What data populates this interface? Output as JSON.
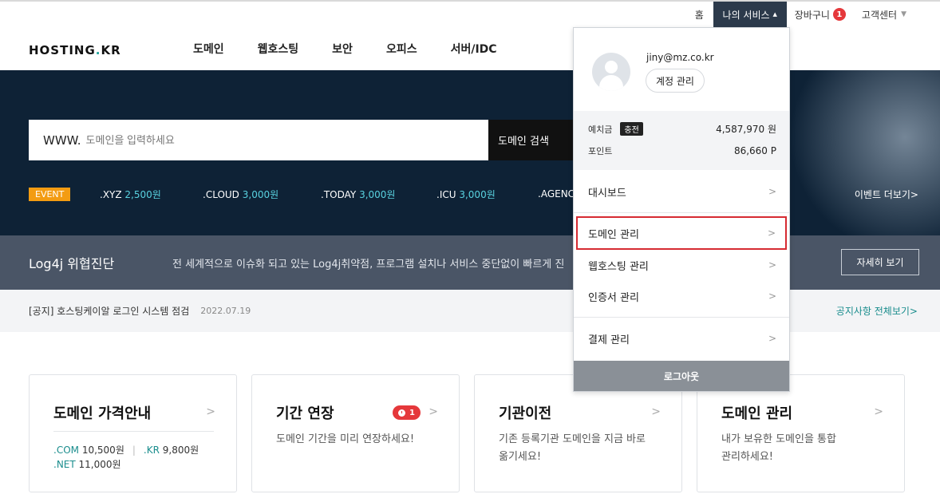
{
  "util": {
    "home": "홈",
    "my_services": "나의 서비스",
    "cart": "장바구니",
    "cart_count": "1",
    "support": "고객센터"
  },
  "logo": {
    "text_a": "HOSTING",
    "dot": ".",
    "text_b": "KR"
  },
  "gnb": [
    "도메인",
    "웹호스팅",
    "보안",
    "오피스",
    "서버/IDC"
  ],
  "search": {
    "prefix": "WWW.",
    "placeholder": "도메인을 입력하세요",
    "button": "도메인 검색"
  },
  "events": {
    "tag": "EVENT",
    "items": [
      {
        "tld": ".XYZ",
        "price": "2,500원"
      },
      {
        "tld": ".CLOUD",
        "price": "3,000원"
      },
      {
        "tld": ".TODAY",
        "price": "3,000원"
      },
      {
        "tld": ".ICU",
        "price": "3,000원"
      },
      {
        "tld": ".AGENC",
        "price": ""
      }
    ],
    "more": "이벤트 더보기>"
  },
  "alert": {
    "title": "Log4j 위협진단",
    "desc": "전 세계적으로 이슈화 되고 있는 Log4j취약점, 프로그램 설치나 서비스 중단없이 빠르게 진",
    "button": "자세히 보기"
  },
  "notice": {
    "text": "[공지] 호스팅케이알 로그인 시스템 점검",
    "date": "2022.07.19",
    "more": "공지사항 전체보기>"
  },
  "cards": [
    {
      "title": "도메인 가격안내",
      "prices": [
        {
          "tld": ".COM",
          "price": "10,500원"
        },
        {
          "tld": ".KR",
          "price": "9,800원"
        },
        {
          "tld": ".NET",
          "price": "11,000원"
        }
      ]
    },
    {
      "title": "기간 연장",
      "desc": "도메인 기간을 미리 연장하세요!",
      "badge": "1"
    },
    {
      "title": "기관이전",
      "desc1": "기존 등록기관 도메인을 지금 바로",
      "desc2": "옮기세요!"
    },
    {
      "title": "도메인 관리",
      "desc1": "내가 보유한 도메인을 통합",
      "desc2": "관리하세요!"
    }
  ],
  "dropdown": {
    "email": "jiny@mz.co.kr",
    "account_button": "계정 관리",
    "deposit_label": "예치금",
    "charge_button": "충전",
    "deposit_value": "4,587,970 원",
    "points_label": "포인트",
    "points_value": "86,660 P",
    "menu": [
      "대시보드",
      "도메인 관리",
      "웹호스팅 관리",
      "인증서 관리",
      "결제 관리"
    ],
    "logout": "로그아웃"
  },
  "colors": {
    "accent": "#1aa39a",
    "dark_navy": "#0e2236",
    "alert_red": "#e5383b",
    "selected_border": "#d62b32",
    "event_orange": "#f39c12"
  }
}
